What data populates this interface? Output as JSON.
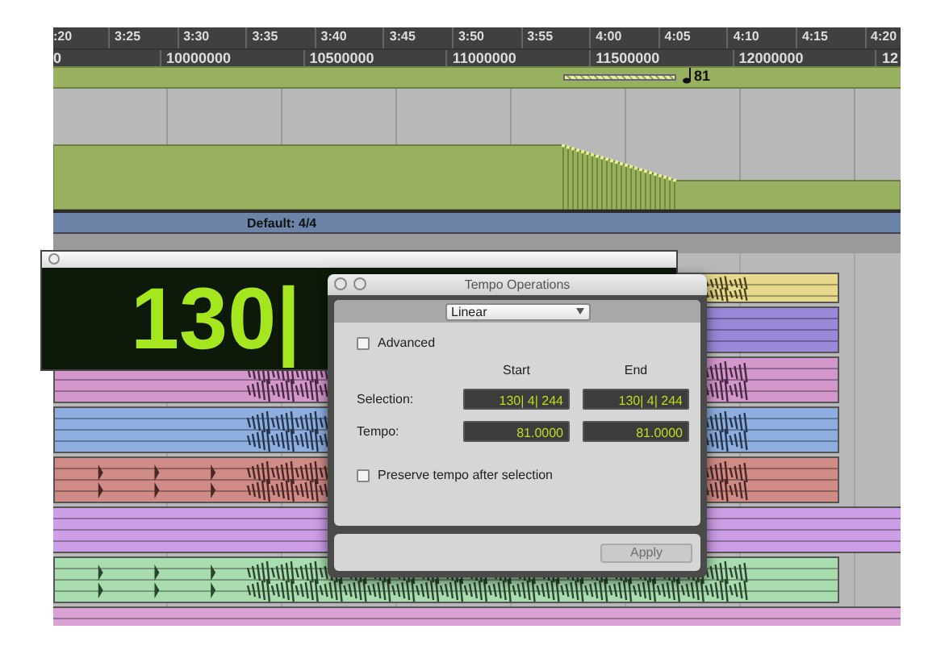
{
  "ruler": {
    "minutes": [
      ":20",
      "3:25",
      "3:30",
      "3:35",
      "3:40",
      "3:45",
      "3:50",
      "3:55",
      "4:00",
      "4:05",
      "4:10",
      "4:15",
      "4:20"
    ],
    "samples": [
      "0",
      "10000000",
      "10500000",
      "11000000",
      "11500000",
      "12000000",
      "12"
    ]
  },
  "tempo_ruler": {
    "marker": "81"
  },
  "meter": {
    "label": "Default: 4/4"
  },
  "counter": {
    "value": "130|"
  },
  "tracks": [
    {
      "color": "#e6d98e",
      "kind": "dense"
    },
    {
      "color": "#9c88d8",
      "kind": "empty"
    },
    {
      "color": "#d497cc",
      "kind": "dense"
    },
    {
      "color": "#8eaee0",
      "kind": "dense"
    },
    {
      "color": "#d08b86",
      "kind": "pulses"
    },
    {
      "color": "#cc9ee6",
      "kind": "region"
    },
    {
      "color": "#a9dcae",
      "kind": "pulses"
    },
    {
      "color": "#d9a1d4",
      "kind": "region"
    }
  ],
  "dialog": {
    "title": "Tempo Operations",
    "mode": "Linear",
    "advanced": {
      "label": "Advanced",
      "checked": false
    },
    "columns": [
      "Start",
      "End"
    ],
    "rows": [
      {
        "label": "Selection:",
        "start": "130| 4| 244",
        "end": "130| 4| 244"
      },
      {
        "label": "Tempo:",
        "start": "81.0000",
        "end": "81.0000"
      }
    ],
    "preserve": {
      "label": "Preserve tempo after selection",
      "checked": false
    },
    "apply": {
      "label": "Apply",
      "disabled": true
    }
  }
}
